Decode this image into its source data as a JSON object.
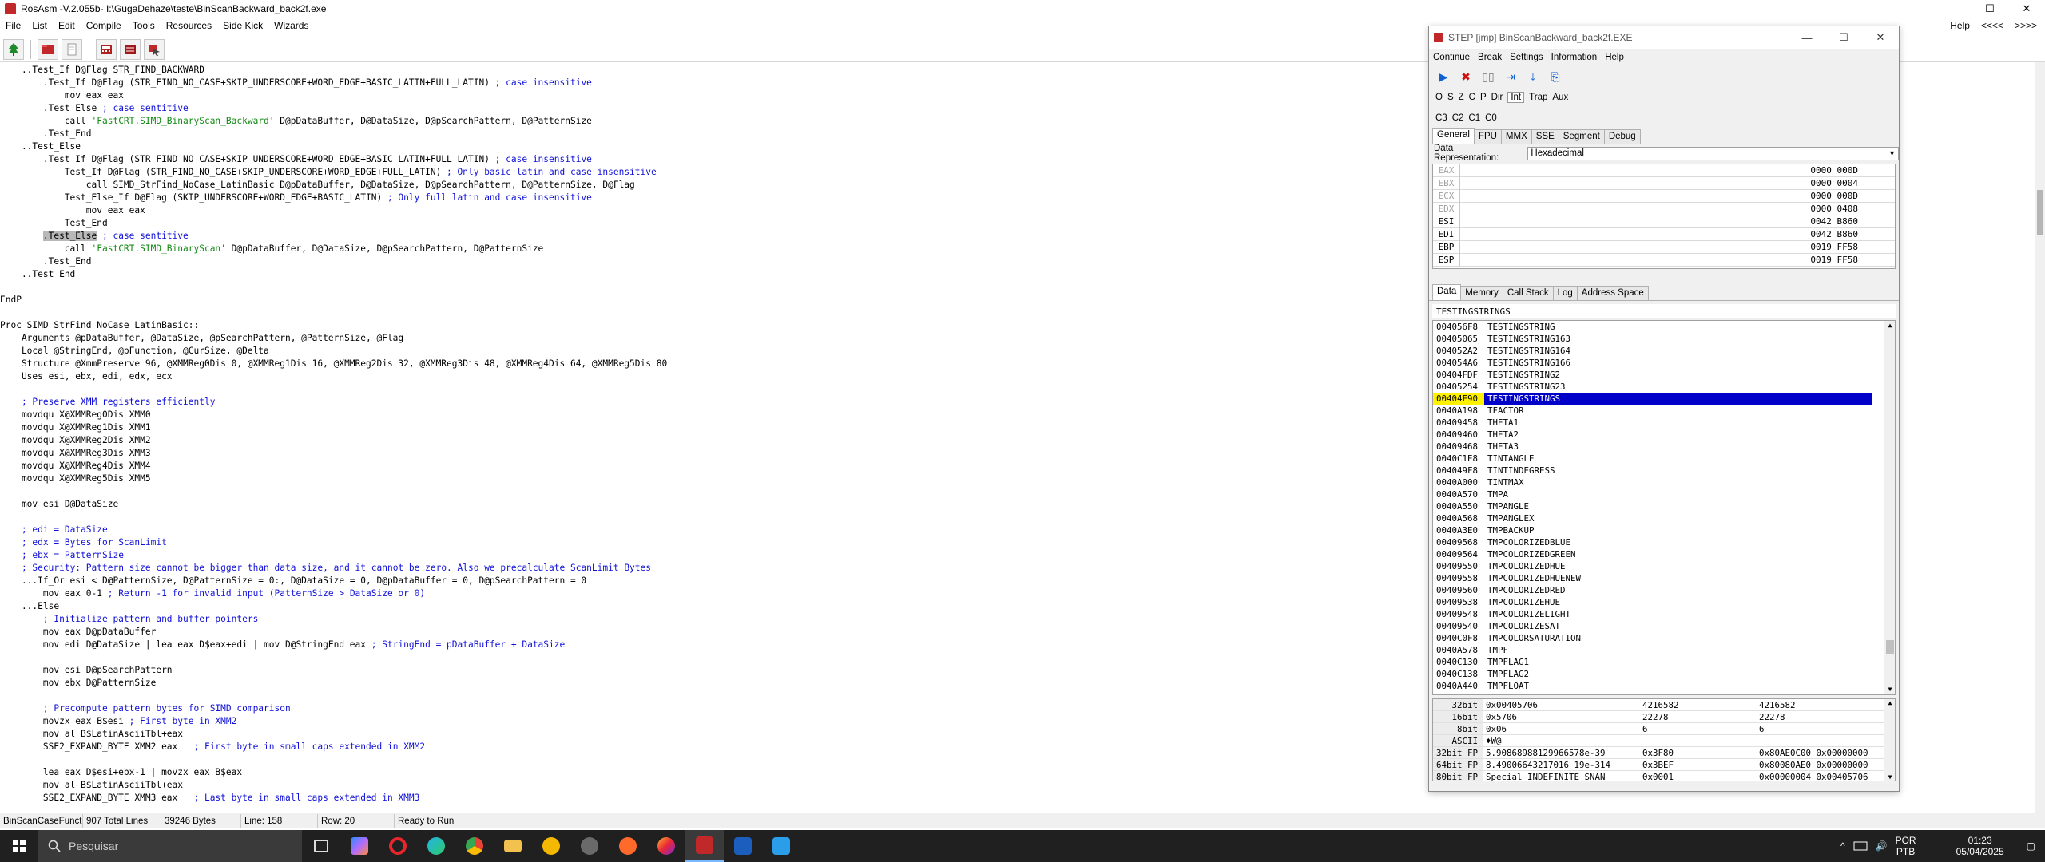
{
  "window": {
    "title": "RosAsm  -V.2.055b-    I:\\GugaDehaze\\teste\\BinScanBackward_back2f.exe",
    "controls": [
      "—",
      "☐",
      "✕"
    ]
  },
  "menu": {
    "items": [
      "File",
      "List",
      "Edit",
      "Compile",
      "Tools",
      "Resources",
      "Side Kick",
      "Wizards"
    ],
    "right": [
      "Help",
      "<<<<",
      ">>>>"
    ]
  },
  "toolbar": {
    "buttons": [
      "tree-icon",
      "open-folder-icon",
      "new-file-icon",
      "calculator-icon",
      "hex-editor-icon",
      "debug-icon"
    ]
  },
  "editor": {
    "lines": [
      {
        "row": 0,
        "text": "    ..Test_If D@Flag STR_FIND_BACKWARD"
      },
      {
        "row": 1,
        "text": "        .Test_If D@Flag (STR_FIND_NO_CASE+SKIP_UNDERSCORE+WORD_EDGE+BASIC_LATIN+FULL_LATIN) ",
        "comment": "; case insensitive"
      },
      {
        "row": 2,
        "text": "            mov eax eax"
      },
      {
        "row": 3,
        "text": "        .Test_Else ",
        "comment": "; case sentitive"
      },
      {
        "row": 4,
        "text": "            call ",
        "string": "'FastCRT.SIMD_BinaryScan_Backward'",
        "rest": " D@pDataBuffer, D@DataSize, D@pSearchPattern, D@PatternSize"
      },
      {
        "row": 5,
        "text": "        .Test_End"
      },
      {
        "row": 6,
        "text": "    ..Test_Else"
      },
      {
        "row": 7,
        "text": "        .Test_If D@Flag (STR_FIND_NO_CASE+SKIP_UNDERSCORE+WORD_EDGE+BASIC_LATIN+FULL_LATIN) ",
        "comment": "; case insensitive"
      },
      {
        "row": 8,
        "text": "            Test_If D@Flag (STR_FIND_NO_CASE+SKIP_UNDERSCORE+WORD_EDGE+FULL_LATIN) ",
        "comment": "; Only basic latin and case insensitive"
      },
      {
        "row": 9,
        "text": "                call SIMD_StrFind_NoCase_LatinBasic D@pDataBuffer, D@DataSize, D@pSearchPattern, D@PatternSize, D@Flag"
      },
      {
        "row": 10,
        "text": "            Test_Else_If D@Flag (SKIP_UNDERSCORE+WORD_EDGE+BASIC_LATIN) ",
        "comment": "; Only full latin and case insensitive"
      },
      {
        "row": 11,
        "text": "                mov eax eax"
      },
      {
        "row": 12,
        "text": "            Test_End"
      },
      {
        "row": 13,
        "pre": "        ",
        "highlight": ".Test_Else",
        "text": " ",
        "comment": "; case sentitive"
      },
      {
        "row": 14,
        "text": "            call ",
        "string": "'FastCRT.SIMD_BinaryScan'",
        "rest": " D@pDataBuffer, D@DataSize, D@pSearchPattern, D@PatternSize"
      },
      {
        "row": 15,
        "text": "        .Test_End"
      },
      {
        "row": 16,
        "text": "    ..Test_End"
      },
      {
        "row": 18,
        "text": "EndP"
      },
      {
        "row": 20,
        "text": "Proc SIMD_StrFind_NoCase_LatinBasic::"
      },
      {
        "row": 21,
        "text": "    Arguments @pDataBuffer, @DataSize, @pSearchPattern, @PatternSize, @Flag"
      },
      {
        "row": 22,
        "text": "    Local @StringEnd, @pFunction, @CurSize, @Delta"
      },
      {
        "row": 23,
        "text": "    Structure @XmmPreserve 96, @XMMReg0Dis 0, @XMMReg1Dis 16, @XMMReg2Dis 32, @XMMReg3Dis 48, @XMMReg4Dis 64, @XMMReg5Dis 80"
      },
      {
        "row": 24,
        "text": "    Uses esi, ebx, edi, edx, ecx"
      },
      {
        "row": 26,
        "text": "    ",
        "comment": "; Preserve XMM registers efficiently"
      },
      {
        "row": 27,
        "text": "    movdqu X@XMMReg0Dis XMM0"
      },
      {
        "row": 28,
        "text": "    movdqu X@XMMReg1Dis XMM1"
      },
      {
        "row": 29,
        "text": "    movdqu X@XMMReg2Dis XMM2"
      },
      {
        "row": 30,
        "text": "    movdqu X@XMMReg3Dis XMM3"
      },
      {
        "row": 31,
        "text": "    movdqu X@XMMReg4Dis XMM4"
      },
      {
        "row": 32,
        "text": "    movdqu X@XMMReg5Dis XMM5"
      },
      {
        "row": 34,
        "text": "    mov esi D@DataSize"
      },
      {
        "row": 36,
        "text": "    ",
        "comment": "; edi = DataSize"
      },
      {
        "row": 37,
        "text": "    ",
        "comment": "; edx = Bytes for ScanLimit"
      },
      {
        "row": 38,
        "text": "    ",
        "comment": "; ebx = PatternSize"
      },
      {
        "row": 39,
        "text": "    ",
        "comment": "; Security: Pattern size cannot be bigger than data size, and it cannot be zero. Also we precalculate ScanLimit Bytes"
      },
      {
        "row": 40,
        "text": "    ...If_Or esi < D@PatternSize, D@PatternSize = 0:, D@DataSize = 0, D@pDataBuffer = 0, D@pSearchPattern = 0"
      },
      {
        "row": 41,
        "text": "        mov eax 0-1 ",
        "comment": "; Return -1 for invalid input (PatternSize > DataSize or 0)"
      },
      {
        "row": 42,
        "text": "    ...Else"
      },
      {
        "row": 43,
        "text": "        ",
        "comment": "; Initialize pattern and buffer pointers"
      },
      {
        "row": 44,
        "text": "        mov eax D@pDataBuffer"
      },
      {
        "row": 45,
        "text": "        mov edi D@DataSize | lea eax D$eax+edi | mov D@StringEnd eax ",
        "comment": "; StringEnd = pDataBuffer + DataSize"
      },
      {
        "row": 47,
        "text": "        mov esi D@pSearchPattern"
      },
      {
        "row": 48,
        "text": "        mov ebx D@PatternSize"
      },
      {
        "row": 50,
        "text": "        ",
        "comment": "; Precompute pattern bytes for SIMD comparison"
      },
      {
        "row": 51,
        "text": "        movzx eax B$esi ",
        "comment": "; First byte in XMM2"
      },
      {
        "row": 52,
        "text": "        mov al B$LatinAsciiTbl+eax"
      },
      {
        "row": 53,
        "text": "        SSE2_EXPAND_BYTE XMM2 eax   ",
        "comment": "; First byte in small caps extended in XMM2"
      },
      {
        "row": 55,
        "text": "        lea eax D$esi+ebx-1 | movzx eax B$eax"
      },
      {
        "row": 56,
        "text": "        mov al B$LatinAsciiTbl+eax"
      },
      {
        "row": 57,
        "text": "        SSE2_EXPAND_BYTE XMM3 eax   ",
        "comment": "; Last byte in small caps extended in XMM3"
      }
    ]
  },
  "status": {
    "proc": "BinScanCaseFunct",
    "total_lines": "907 Total Lines",
    "bytes": "39246 Bytes",
    "line": "Line: 158",
    "row": "Row: 20",
    "state": "Ready to Run"
  },
  "debugger": {
    "title": "STEP [jmp] BinScanBackward_back2f.EXE",
    "menu": [
      "Continue",
      "Break",
      "Settings",
      "Information",
      "Help"
    ],
    "tools": [
      "▶",
      "✖",
      "▯▯",
      "⇥",
      "⤓",
      "⎘"
    ],
    "flags": [
      "O",
      "S",
      "Z",
      "C",
      "P",
      "Dir",
      "Int",
      "Trap",
      "Aux"
    ],
    "cflags": [
      "C3",
      "C2",
      "C1",
      "C0"
    ],
    "reg_tabs": [
      "General",
      "FPU",
      "MMX",
      "SSE",
      "Segment",
      "Debug"
    ],
    "repr_label": "Data Representation:",
    "repr_value": "Hexadecimal",
    "registers": [
      {
        "name": "EAX",
        "value": "0000 000D",
        "grey": true
      },
      {
        "name": "EBX",
        "value": "0000 0004",
        "grey": true
      },
      {
        "name": "ECX",
        "value": "0000 000D",
        "grey": true
      },
      {
        "name": "EDX",
        "value": "0000 0408",
        "grey": true
      },
      {
        "name": "ESI",
        "value": "0042 B860",
        "grey": false
      },
      {
        "name": "EDI",
        "value": "0042 B860",
        "grey": false
      },
      {
        "name": "EBP",
        "value": "0019 FF58",
        "grey": false
      },
      {
        "name": "ESP",
        "value": "0019 FF58",
        "grey": false
      }
    ],
    "data_tabs": [
      "Data",
      "Memory",
      "Call Stack",
      "Log",
      "Address Space"
    ],
    "search_value": "TESTINGSTRINGS",
    "symbols": [
      {
        "addr": "004056F8",
        "name": "TESTINGSTRING"
      },
      {
        "addr": "00405065",
        "name": "TESTINGSTRING163"
      },
      {
        "addr": "004052A2",
        "name": "TESTINGSTRING164"
      },
      {
        "addr": "004054A6",
        "name": "TESTINGSTRING166"
      },
      {
        "addr": "00404FDF",
        "name": "TESTINGSTRING2"
      },
      {
        "addr": "00405254",
        "name": "TESTINGSTRING23"
      },
      {
        "addr": "00404F90",
        "name": "TESTINGSTRINGS",
        "selected": true
      },
      {
        "addr": "0040A198",
        "name": "TFACTOR"
      },
      {
        "addr": "00409458",
        "name": "THETA1"
      },
      {
        "addr": "00409460",
        "name": "THETA2"
      },
      {
        "addr": "00409468",
        "name": "THETA3"
      },
      {
        "addr": "0040C1E8",
        "name": "TINTANGLE"
      },
      {
        "addr": "004049F8",
        "name": "TINTINDEGRESS"
      },
      {
        "addr": "0040A000",
        "name": "TINTMAX"
      },
      {
        "addr": "0040A570",
        "name": "TMPA"
      },
      {
        "addr": "0040A550",
        "name": "TMPANGLE"
      },
      {
        "addr": "0040A568",
        "name": "TMPANGLEX"
      },
      {
        "addr": "0040A3E0",
        "name": "TMPBACKUP"
      },
      {
        "addr": "00409568",
        "name": "TMPCOLORIZEDBLUE"
      },
      {
        "addr": "00409564",
        "name": "TMPCOLORIZEDGREEN"
      },
      {
        "addr": "00409550",
        "name": "TMPCOLORIZEDHUE"
      },
      {
        "addr": "00409558",
        "name": "TMPCOLORIZEDHUENEW"
      },
      {
        "addr": "00409560",
        "name": "TMPCOLORIZEDRED"
      },
      {
        "addr": "00409538",
        "name": "TMPCOLORIZEHUE"
      },
      {
        "addr": "00409548",
        "name": "TMPCOLORIZELIGHT"
      },
      {
        "addr": "00409540",
        "name": "TMPCOLORIZESAT"
      },
      {
        "addr": "0040C0F8",
        "name": "TMPCOLORSATURATION"
      },
      {
        "addr": "0040A578",
        "name": "TMPF"
      },
      {
        "addr": "0040C130",
        "name": "TMPFLAG1"
      },
      {
        "addr": "0040C138",
        "name": "TMPFLAG2"
      },
      {
        "addr": "0040A440",
        "name": "TMPFLOAT"
      }
    ],
    "values": [
      {
        "label": "32bit",
        "c1": "0x00405706",
        "c2": "4216582",
        "c3": "4216582"
      },
      {
        "label": "16bit",
        "c1": "0x5706",
        "c2": "22278",
        "c3": "22278"
      },
      {
        "label": "8bit",
        "c1": "0x06",
        "c2": "6",
        "c3": "6"
      },
      {
        "label": "ASCII",
        "c1": "♦W@",
        "c2": "",
        "c3": ""
      },
      {
        "label": "32bit FP",
        "c1": "5.90868988129966578e-39",
        "c2": "0x3F80",
        "c3": "0x80AE0C00 0x00000000"
      },
      {
        "label": "64bit FP",
        "c1": "8.49006643217016 19e-314",
        "c2": "0x3BEF",
        "c3": "0x80080AE0 0x00000000"
      },
      {
        "label": "80bit FP",
        "c1": "Special INDEFINITE SNAN",
        "c2": "0x0001",
        "c3": "0x00000004 0x00405706"
      }
    ]
  },
  "taskbar": {
    "search_placeholder": "Pesquisar",
    "apps": [
      "task-view-icon",
      "copilot-icon",
      "opera-icon",
      "edge-icon",
      "chrome-icon",
      "file-explorer-icon",
      "app-icon",
      "app-icon",
      "app-icon",
      "firefox-icon",
      "rosasm-icon",
      "word-icon",
      "paint-icon"
    ],
    "lang1": "POR",
    "lang2": "PTB",
    "time": "01:23",
    "date": "05/04/2025"
  },
  "colors": {
    "comment": "#1010d8",
    "string": "#118a11",
    "selection": "#0000c8",
    "selected_addr": "#fff200",
    "taskbar": "#202020"
  }
}
